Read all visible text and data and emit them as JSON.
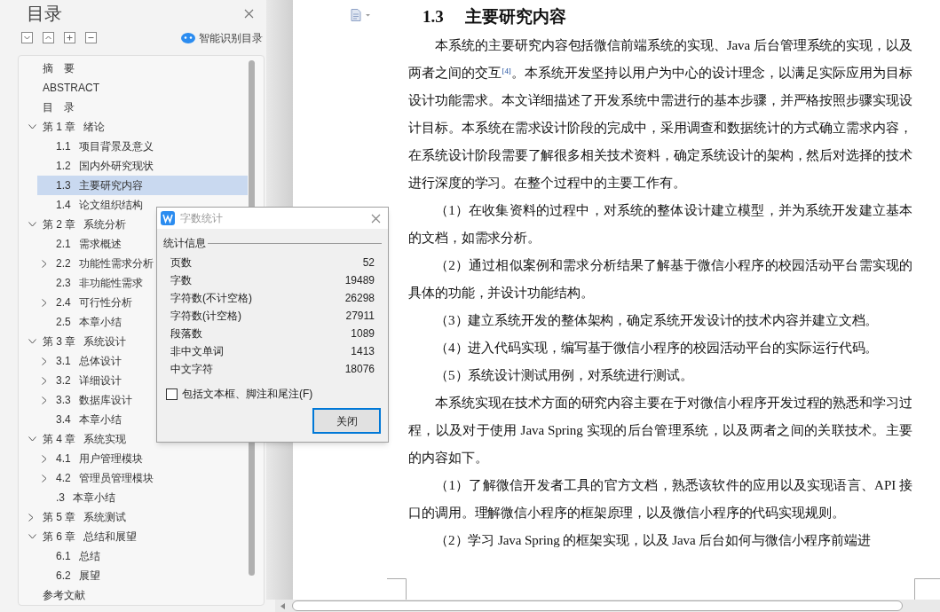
{
  "outline_panel": {
    "title": "目录",
    "smart_button": "智能识别目录",
    "items": [
      {
        "title": "摘　要",
        "selected": false
      },
      {
        "title": "ABSTRACT",
        "selected": false
      },
      {
        "title": "目　录",
        "selected": false
      },
      {
        "number": "第 1 章",
        "title": "绪论",
        "selected": false,
        "expanded": true,
        "children": [
          {
            "number": "1.1",
            "title": "项目背景及意义",
            "selected": false
          },
          {
            "number": "1.2",
            "title": "国内外研究现状",
            "selected": false
          },
          {
            "number": "1.3",
            "title": "主要研究内容",
            "selected": true
          },
          {
            "number": "1.4",
            "title": "论文组织结构",
            "selected": false
          }
        ]
      },
      {
        "number": "第 2 章",
        "title": "系统分析",
        "selected": false,
        "expanded": true,
        "children": [
          {
            "number": "2.1",
            "title": "需求概述",
            "selected": false
          },
          {
            "number": "2.2",
            "title": "功能性需求分析",
            "selected": false,
            "expanded": false
          },
          {
            "number": "2.3",
            "title": "非功能性需求",
            "selected": false
          },
          {
            "number": "2.4",
            "title": "可行性分析",
            "selected": false,
            "expanded": false
          },
          {
            "number": "2.5",
            "title": "本章小结",
            "selected": false
          }
        ]
      },
      {
        "number": "第 3 章",
        "title": "系统设计",
        "selected": false,
        "expanded": true,
        "children": [
          {
            "number": "3.1",
            "title": "总体设计",
            "selected": false,
            "expanded": false
          },
          {
            "number": "3.2",
            "title": "详细设计",
            "selected": false,
            "expanded": false
          },
          {
            "number": "3.3",
            "title": "数据库设计",
            "selected": false,
            "expanded": false
          },
          {
            "number": "3.4",
            "title": "本章小结",
            "selected": false
          }
        ]
      },
      {
        "number": "第 4 章",
        "title": "系统实现",
        "selected": false,
        "expanded": true,
        "children": [
          {
            "number": "4.1",
            "title": "用户管理模块",
            "selected": false,
            "expanded": false
          },
          {
            "number": "4.2",
            "title": "管理员管理模块",
            "selected": false,
            "expanded": false
          },
          {
            "number": ".3",
            "title": "本章小结",
            "selected": false
          }
        ]
      },
      {
        "number": "第 5 章",
        "title": "系统测试",
        "selected": false,
        "expanded": false
      },
      {
        "number": "第 6 章",
        "title": "总结和展望",
        "selected": false,
        "expanded": true,
        "children": [
          {
            "number": "6.1",
            "title": "总结",
            "selected": false
          },
          {
            "number": "6.2",
            "title": "展望",
            "selected": false
          }
        ]
      },
      {
        "title": "参考文献",
        "selected": false
      }
    ]
  },
  "document": {
    "heading": {
      "number": "1.3",
      "title": "主要研究内容"
    },
    "paragraphs": [
      "本系统的主要研究内容包括微信前端系统的实现、Java 后台管理系统的实现，以及两者之间的交互$^{[4]}$。本系统开发坚持以用户为中心的设计理念，以满足实际应用为目标设计功能需求。本文详细描述了开发系统中需进行的基本步骤，并严格按照步骤实现设计目标。本系统在需求设计阶段的完成中，采用调查和数据统计的方式确立需求内容，在系统设计阶段需要了解很多相关技术资料，确定系统设计的架构，然后对选择的技术进行深度的学习。在整个过程中的主要工作有。",
      "（1）在收集资料的过程中，对系统的整体设计建立模型，并为系统开发建立基本的文档，如需求分析。",
      "（2）通过相似案例和需求分析结果了解基于微信小程序的校园活动平台需实现的具体的功能，并设计功能结构。",
      "（3）建立系统开发的整体架构，确定系统开发设计的技术内容并建立文档。",
      "（4）进入代码实现，编写基于微信小程序的校园活动平台的实际运行代码。",
      "（5）系统设计测试用例，对系统进行测试。",
      "本系统实现在技术方面的研究内容主要在于对微信小程序开发过程的熟悉和学习过程，以及对于使用 Java Spring 实现的后台管理系统，以及两者之间的关联技术。主要的内容如下。",
      "（1）了解微信开发者工具的官方文档，熟悉该软件的应用以及实现语言、API 接口的调用。理解微信小程序的框架原理，以及微信小程序的代码实现规则。",
      "（2）学习 Java Spring 的框架实现，以及 Java 后台如何与微信小程序前端进"
    ]
  },
  "dialog": {
    "title": "字数统计",
    "group": "统计信息",
    "stats": [
      {
        "label": "页数",
        "value": "52"
      },
      {
        "label": "字数",
        "value": "19489"
      },
      {
        "label": "字符数(不计空格)",
        "value": "26298"
      },
      {
        "label": "字符数(计空格)",
        "value": "27911"
      },
      {
        "label": "段落数",
        "value": "1089"
      },
      {
        "label": "非中文单词",
        "value": "1413"
      },
      {
        "label": "中文字符",
        "value": "18076"
      }
    ],
    "checkbox": {
      "label": "包括文本框、脚注和尾注(F)",
      "checked": false
    },
    "button": "关闭"
  }
}
